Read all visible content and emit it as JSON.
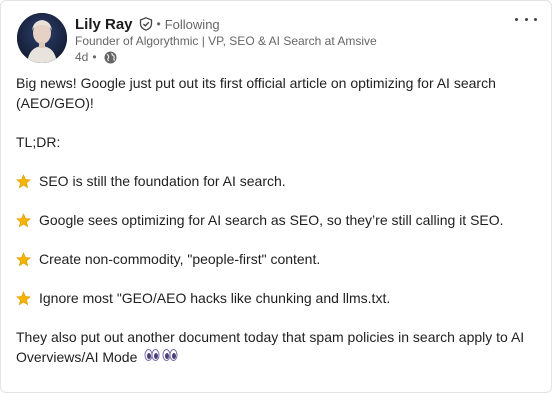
{
  "author": {
    "name": "Lily Ray",
    "follow_status": "Following",
    "headline": "Founder of Algorythmic | VP, SEO & AI Search at Amsive",
    "time": "4d",
    "visibility_icon": "globe-icon",
    "verified_icon": "verified-badge-icon"
  },
  "post": {
    "intro": "Big news! Google just put out its first official article on optimizing for AI search (AEO/GEO)!",
    "tldr_label": "TL;DR:",
    "bullets": [
      {
        "icon": "star-icon",
        "text": "SEO is still the foundation for AI search."
      },
      {
        "icon": "star-icon",
        "text": "Google sees optimizing for AI search as SEO, so they’re still calling it SEO."
      },
      {
        "icon": "star-icon",
        "text": "Create non-commodity, \"people-first\" content."
      },
      {
        "icon": "star-icon",
        "text": "Ignore most \"GEO/AEO hacks like chunking and llms.txt."
      }
    ],
    "outro": "They also put out another document today that spam policies in search apply to AI Overviews/AI Mode",
    "outro_emoji": "eyes-icon"
  },
  "colors": {
    "text": "#1f1f1f",
    "muted": "#666666",
    "star": "#f4b400"
  }
}
